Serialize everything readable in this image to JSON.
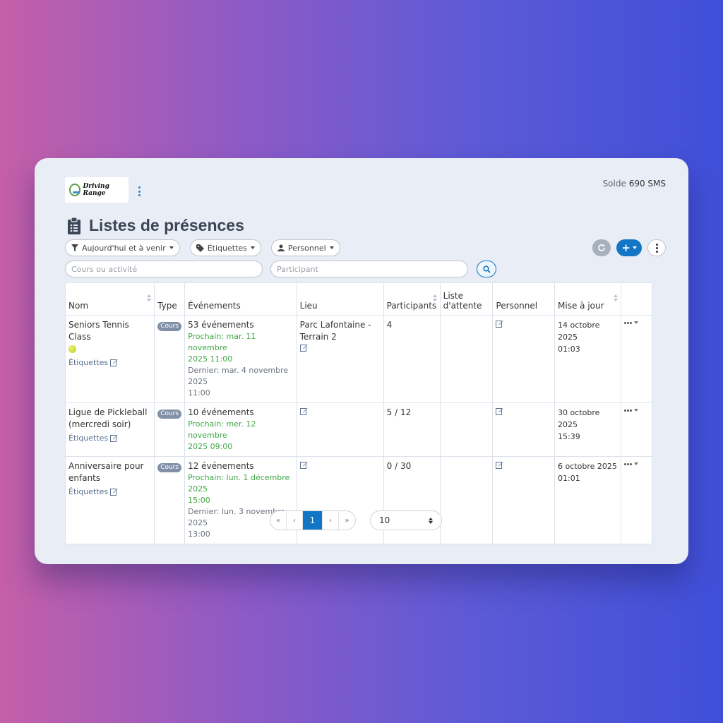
{
  "brand": {
    "logo_text": "Driving Range"
  },
  "header": {
    "balance_label": "Solde",
    "balance_value": "690 SMS",
    "title": "Listes de présences"
  },
  "filters": {
    "date": "Aujourd'hui et à venir",
    "tags": "Étiquettes",
    "staff": "Personnel"
  },
  "search": {
    "course_placeholder": "Cours ou activité",
    "participant_placeholder": "Participant"
  },
  "table": {
    "headers": {
      "name": "Nom",
      "type": "Type",
      "events": "Événements",
      "location": "Lieu",
      "participants": "Participants",
      "waitlist_1": "Liste",
      "waitlist_2": "d'attente",
      "staff": "Personnel",
      "updated": "Mise à jour"
    },
    "rows": [
      {
        "name": "Seniors Tennis Class",
        "tags": "Étiquettes",
        "type": "Cours",
        "events_count": "53 événements",
        "next_1": "Prochain: mar. 11 novembre",
        "next_2": "2025 11:00",
        "last_1": "Dernier: mar. 4 novembre 2025",
        "last_2": "11:00",
        "location_1": "Parc Lafontaine -",
        "location_2": "Terrain 2",
        "participants": "4",
        "waitlist": "",
        "updated_1": "14 octobre 2025",
        "updated_2": "01:03"
      },
      {
        "name_1": "Ligue de Pickleball",
        "name_2": "(mercredi soir)",
        "tags": "Étiquettes",
        "type": "Cours",
        "events_count": "10 événements",
        "next_1": "Prochain: mer. 12 novembre",
        "next_2": "2025 09:00",
        "participants": "5 / 12",
        "waitlist": "",
        "updated_1": "30 octobre 2025",
        "updated_2": "15:39"
      },
      {
        "name_1": "Anniversaire pour",
        "name_2": "enfants",
        "tags": "Étiquettes",
        "type": "Cours",
        "events_count": "12 événements",
        "next_1": "Prochain: lun. 1 décembre 2025",
        "next_2": "15:00",
        "last_1": "Dernier: lun. 3 novembre 2025",
        "last_2": "13:00",
        "participants": "0 / 30",
        "waitlist": "",
        "updated_1": "6 octobre 2025",
        "updated_2": "01:01"
      }
    ]
  },
  "pagination": {
    "first": "«",
    "prev": "‹",
    "current": "1",
    "next": "›",
    "last": "»",
    "page_size": "10"
  },
  "colors": {
    "primary": "#1275c5",
    "next_green": "#3fa845",
    "badge": "#8190a7",
    "card_bg": "#e9edf5"
  }
}
